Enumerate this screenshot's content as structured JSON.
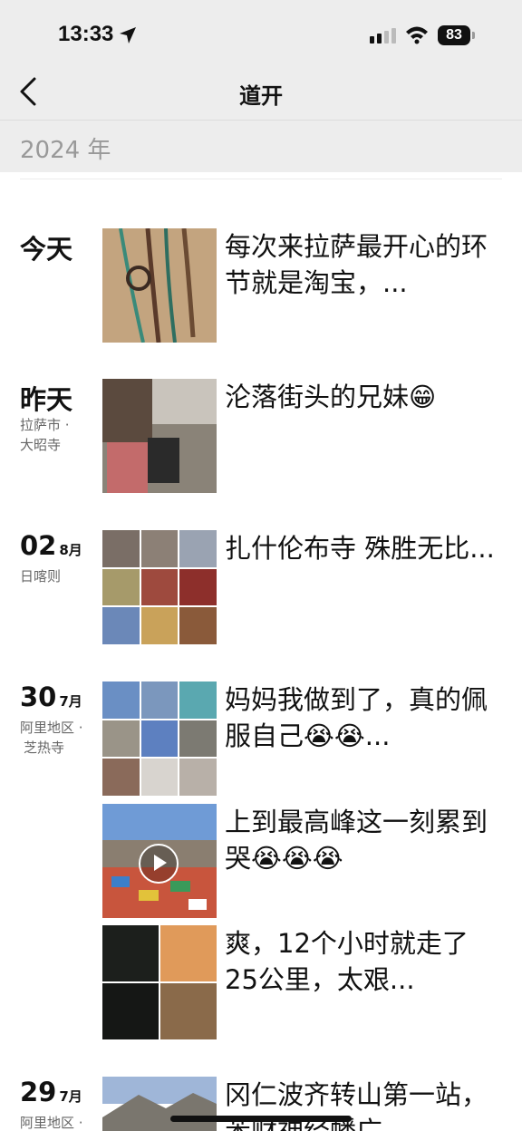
{
  "status": {
    "time": "13:33",
    "battery": "83"
  },
  "nav": {
    "title": "道开"
  },
  "year_label": "2024 年",
  "entries": [
    {
      "day": "今天",
      "month": "",
      "loc1": "",
      "loc2": "",
      "caption": "每次来拉萨最开心的环节就是淘宝，..."
    },
    {
      "day": "昨天",
      "month": "",
      "loc1": "拉萨市 ·",
      "loc2": "大昭寺",
      "caption": "沦落街头的兄妹😁"
    },
    {
      "day": "02",
      "month": "8月",
      "loc1": "日喀则",
      "loc2": "",
      "caption": "扎什伦布寺 殊胜无比..."
    },
    {
      "day": "30",
      "month": "7月",
      "loc1": "阿里地区 ·",
      "loc2": "芝热寺",
      "caption": "妈妈我做到了，真的佩服自己😭😭..."
    },
    {
      "day": "",
      "month": "",
      "loc1": "",
      "loc2": "",
      "caption": "上到最高峰这一刻累到哭😭😭😭"
    },
    {
      "day": "",
      "month": "",
      "loc1": "",
      "loc2": "",
      "caption": "爽，12个小时就走了25公里，太艰..."
    },
    {
      "day": "29",
      "month": "7月",
      "loc1": "阿里地区 ·",
      "loc2": "",
      "caption": "冈仁波齐转山第一站，苯财神经幡广"
    }
  ],
  "colors": {
    "bar_bg": "#ededed",
    "muted": "#999999"
  }
}
